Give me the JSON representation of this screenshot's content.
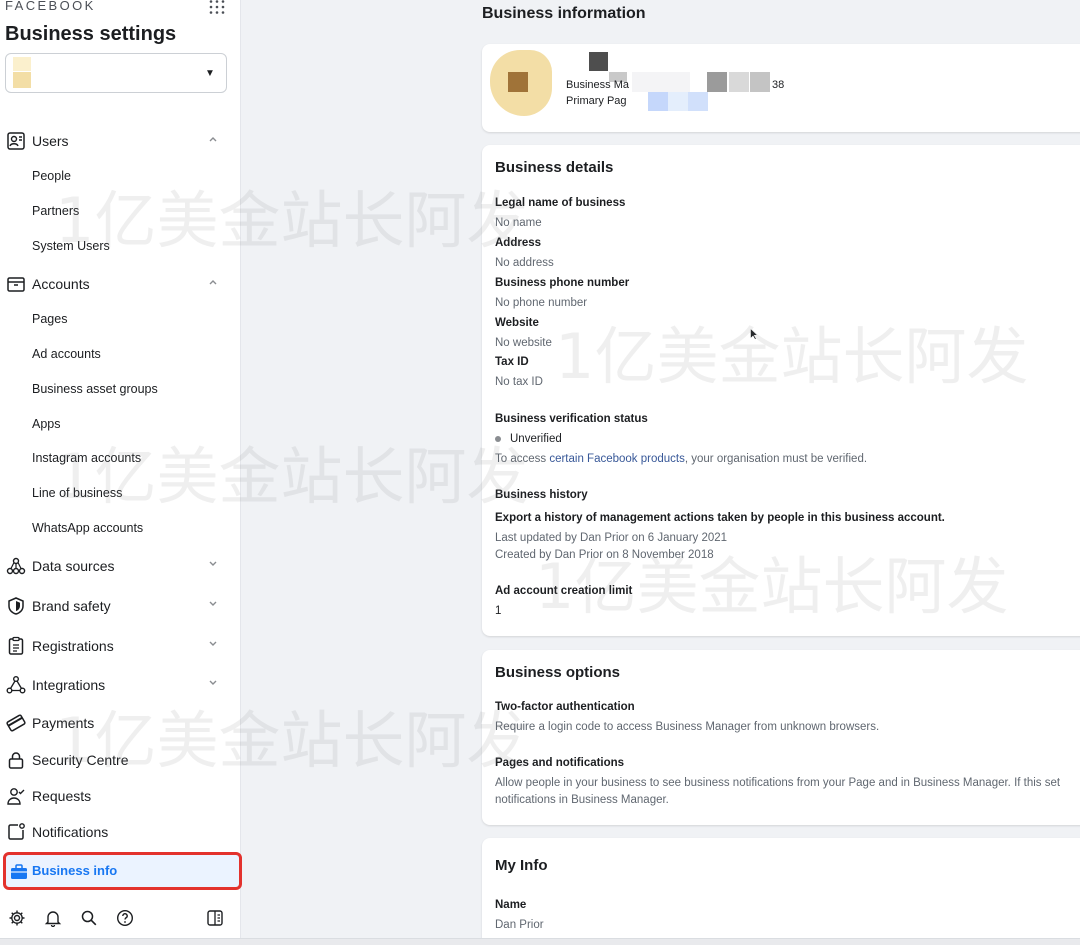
{
  "sidebar": {
    "brand": "FACEBOOK",
    "title": "Business settings",
    "sections": {
      "users": {
        "label": "Users",
        "items": [
          "People",
          "Partners",
          "System Users"
        ]
      },
      "accounts": {
        "label": "Accounts",
        "items": [
          "Pages",
          "Ad accounts",
          "Business asset groups",
          "Apps",
          "Instagram accounts",
          "Line of business",
          "WhatsApp accounts"
        ]
      },
      "data_sources": "Data sources",
      "brand_safety": "Brand safety",
      "registrations": "Registrations",
      "integrations": "Integrations",
      "payments": "Payments",
      "security_centre": "Security Centre",
      "requests": "Requests",
      "notifications": "Notifications",
      "business_info": "Business info"
    }
  },
  "main": {
    "title": "Business information",
    "profile": {
      "line1": "Business Ma",
      "line1_suffix": "38",
      "line2": "Primary Pag"
    },
    "details": {
      "heading": "Business details",
      "legal_name_label": "Legal name of business",
      "legal_name_value": "No name",
      "address_label": "Address",
      "address_value": "No address",
      "phone_label": "Business phone number",
      "phone_value": "No phone number",
      "website_label": "Website",
      "website_value": "No website",
      "tax_label": "Tax ID",
      "tax_value": "No tax ID",
      "verification_label": "Business verification status",
      "verification_value": "Unverified",
      "verification_note_pre": "To access ",
      "verification_note_link": "certain Facebook products",
      "verification_note_post": ", your organisation must be verified.",
      "history_label": "Business history",
      "history_desc": "Export a history of management actions taken by people in this business account.",
      "history_updated": "Last updated by Dan Prior on 6 January 2021",
      "history_created": "Created by Dan Prior on 8 November 2018",
      "limit_label": "Ad account creation limit",
      "limit_value": "1"
    },
    "options": {
      "heading": "Business options",
      "twofa_label": "Two-factor authentication",
      "twofa_desc": "Require a login code to access Business Manager from unknown browsers.",
      "pages_label": "Pages and notifications",
      "pages_desc_line1": "Allow people in your business to see business notifications from your Page and in Business Manager. If this set",
      "pages_desc_line2": "notifications in Business Manager."
    },
    "my_info": {
      "heading": "My Info",
      "name_label": "Name",
      "name_value": "Dan Prior"
    }
  },
  "watermark": "1亿美金站长阿发",
  "colors": {
    "accent": "#1877f2",
    "highlight_border": "#e3322d",
    "link": "#385898"
  }
}
